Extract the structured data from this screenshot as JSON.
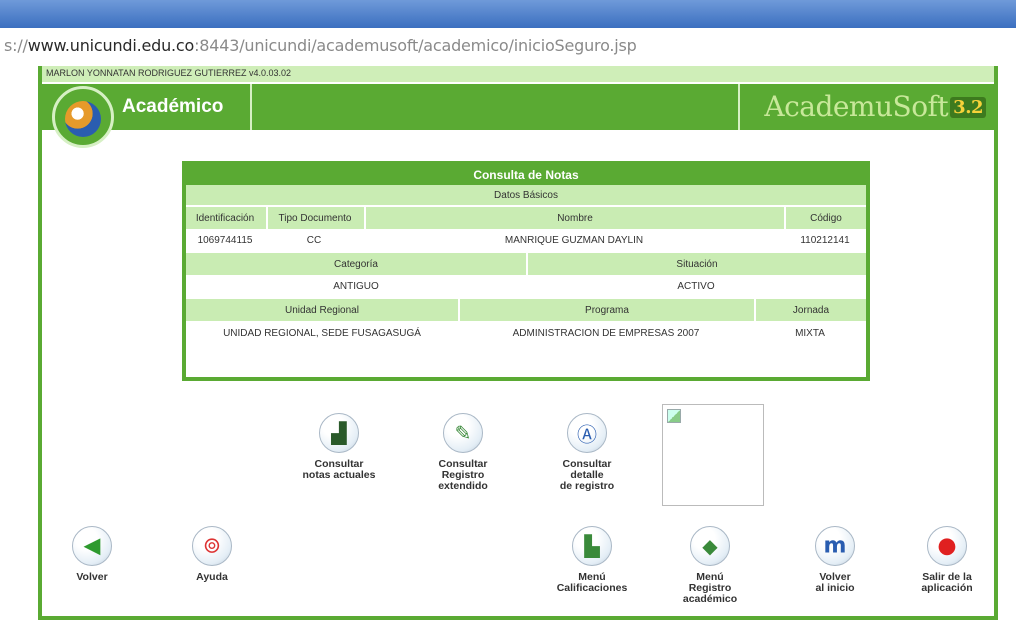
{
  "browser": {
    "url_prefix": "s://",
    "url_host": "www.unicundi.edu.co",
    "url_rest": ":8443/unicundi/academusoft/academico/inicioSeguro.jsp"
  },
  "app": {
    "user_line": "MARLON YONNATAN RODRIGUEZ GUTIERREZ v4.0.03.02",
    "module_title": "Académico",
    "brand_name": "AcademuSoft",
    "brand_version": "3.2"
  },
  "panel": {
    "title": "Consulta de Notas",
    "section_basic": "Datos Básicos",
    "h_identificacion": "Identificación",
    "h_tipo_documento": "Tipo Documento",
    "h_nombre": "Nombre",
    "h_codigo": "Código",
    "v_identificacion": "1069744115",
    "v_tipo_documento": "CC",
    "v_nombre": "MANRIQUE GUZMAN DAYLIN",
    "v_codigo": "110212141",
    "h_categoria": "Categoría",
    "h_situacion": "Situación",
    "v_categoria": "ANTIGUO",
    "v_situacion": "ACTIVO",
    "h_unidad": "Unidad Regional",
    "h_programa": "Programa",
    "h_jornada": "Jornada",
    "v_unidad": "UNIDAD REGIONAL, SEDE FUSAGASUGÁ",
    "v_programa": "ADMINISTRACION DE EMPRESAS 2007",
    "v_jornada": "MIXTA"
  },
  "actions": {
    "consultar_notas_1": "Consultar",
    "consultar_notas_2": "notas actuales",
    "consultar_registro_1": "Consultar",
    "consultar_registro_2": "Registro",
    "consultar_registro_3": "extendido",
    "consultar_detalle_1": "Consultar",
    "consultar_detalle_2": "detalle",
    "consultar_detalle_3": "de registro",
    "volver": "Volver",
    "ayuda": "Ayuda",
    "menu_calif_1": "Menú",
    "menu_calif_2": "Calificaciones",
    "menu_reg_1": "Menú",
    "menu_reg_2": "Registro",
    "menu_reg_3": "académico",
    "volver_inicio_1": "Volver",
    "volver_inicio_2": "al inicio",
    "salir_1": "Salir de la",
    "salir_2": "aplicación"
  },
  "colors": {
    "accent_green": "#5aaa33",
    "light_green": "#c9ecb3",
    "titlebar_blue": "#3b6fc0"
  }
}
